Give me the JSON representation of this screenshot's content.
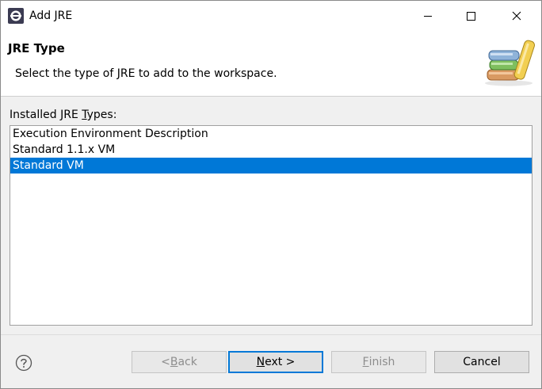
{
  "window": {
    "title": "Add JRE"
  },
  "header": {
    "title": "JRE Type",
    "description": "Select the type of JRE to add to the workspace."
  },
  "list": {
    "label_prefix": "Installed JRE ",
    "label_mnemonic": "T",
    "label_suffix": "ypes:",
    "items": [
      "Execution Environment Description",
      "Standard 1.1.x VM",
      "Standard VM"
    ],
    "selected": "Standard VM"
  },
  "buttons": {
    "back_prefix": "< ",
    "back_mnemonic": "B",
    "back_suffix": "ack",
    "next_mnemonic": "N",
    "next_suffix": "ext >",
    "finish_mnemonic": "F",
    "finish_suffix": "inish",
    "cancel": "Cancel"
  },
  "icons": {
    "app": "eclipse-icon",
    "header": "books-icon",
    "help": "help-icon"
  },
  "colors": {
    "selection": "#0078d7",
    "disabled_text": "#8d8d8d"
  }
}
